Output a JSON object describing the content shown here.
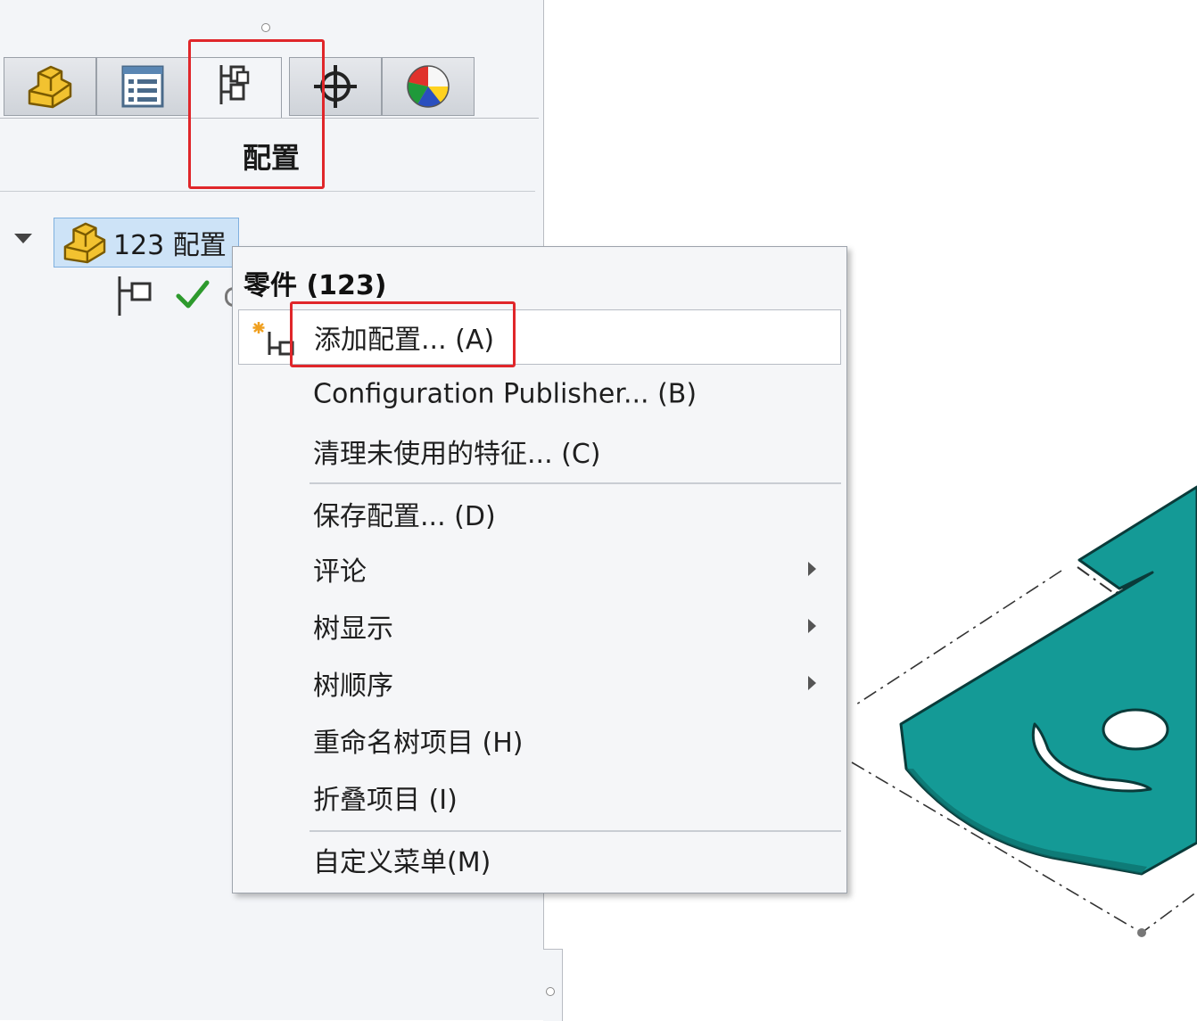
{
  "feature_manager": {
    "tabs": [
      {
        "name": "featuremanager-tab",
        "icon": "part-icon"
      },
      {
        "name": "propertymanager-tab",
        "icon": "property-list-icon"
      },
      {
        "name": "configurationmanager-tab",
        "icon": "configuration-tree-icon",
        "active": true
      },
      {
        "name": "dimxpert-tab",
        "icon": "crosshair-target-icon"
      },
      {
        "name": "displaymanager-tab",
        "icon": "appearance-sphere-icon"
      }
    ],
    "active_tab_caption": "配置",
    "tree": {
      "root_label": "123 配置",
      "root_icon": "part-icon",
      "child_icon": "configuration-icon",
      "active_marker_icon": "green-check-icon"
    }
  },
  "context_menu": {
    "header": "零件 (123)",
    "items": [
      {
        "label": "添加配置... (A)",
        "highlighted": true,
        "icon": "add-configuration-icon"
      },
      {
        "label": "Configuration Publisher... (B)"
      },
      {
        "label": "清理未使用的特征... (C)"
      },
      {
        "label": "保存配置... (D)"
      },
      {
        "label": "评论",
        "submenu": true
      },
      {
        "label": "树显示",
        "submenu": true
      },
      {
        "label": "树顺序",
        "submenu": true
      },
      {
        "label": "重命名树项目 (H)"
      },
      {
        "label": "折叠项目 (I)"
      },
      {
        "label": "自定义菜单(M)"
      }
    ]
  },
  "colors": {
    "highlight_box": "#e0262a",
    "part_fill": "#149a96",
    "selection_bg": "#cde3f7",
    "check_green": "#2d9a2d"
  }
}
